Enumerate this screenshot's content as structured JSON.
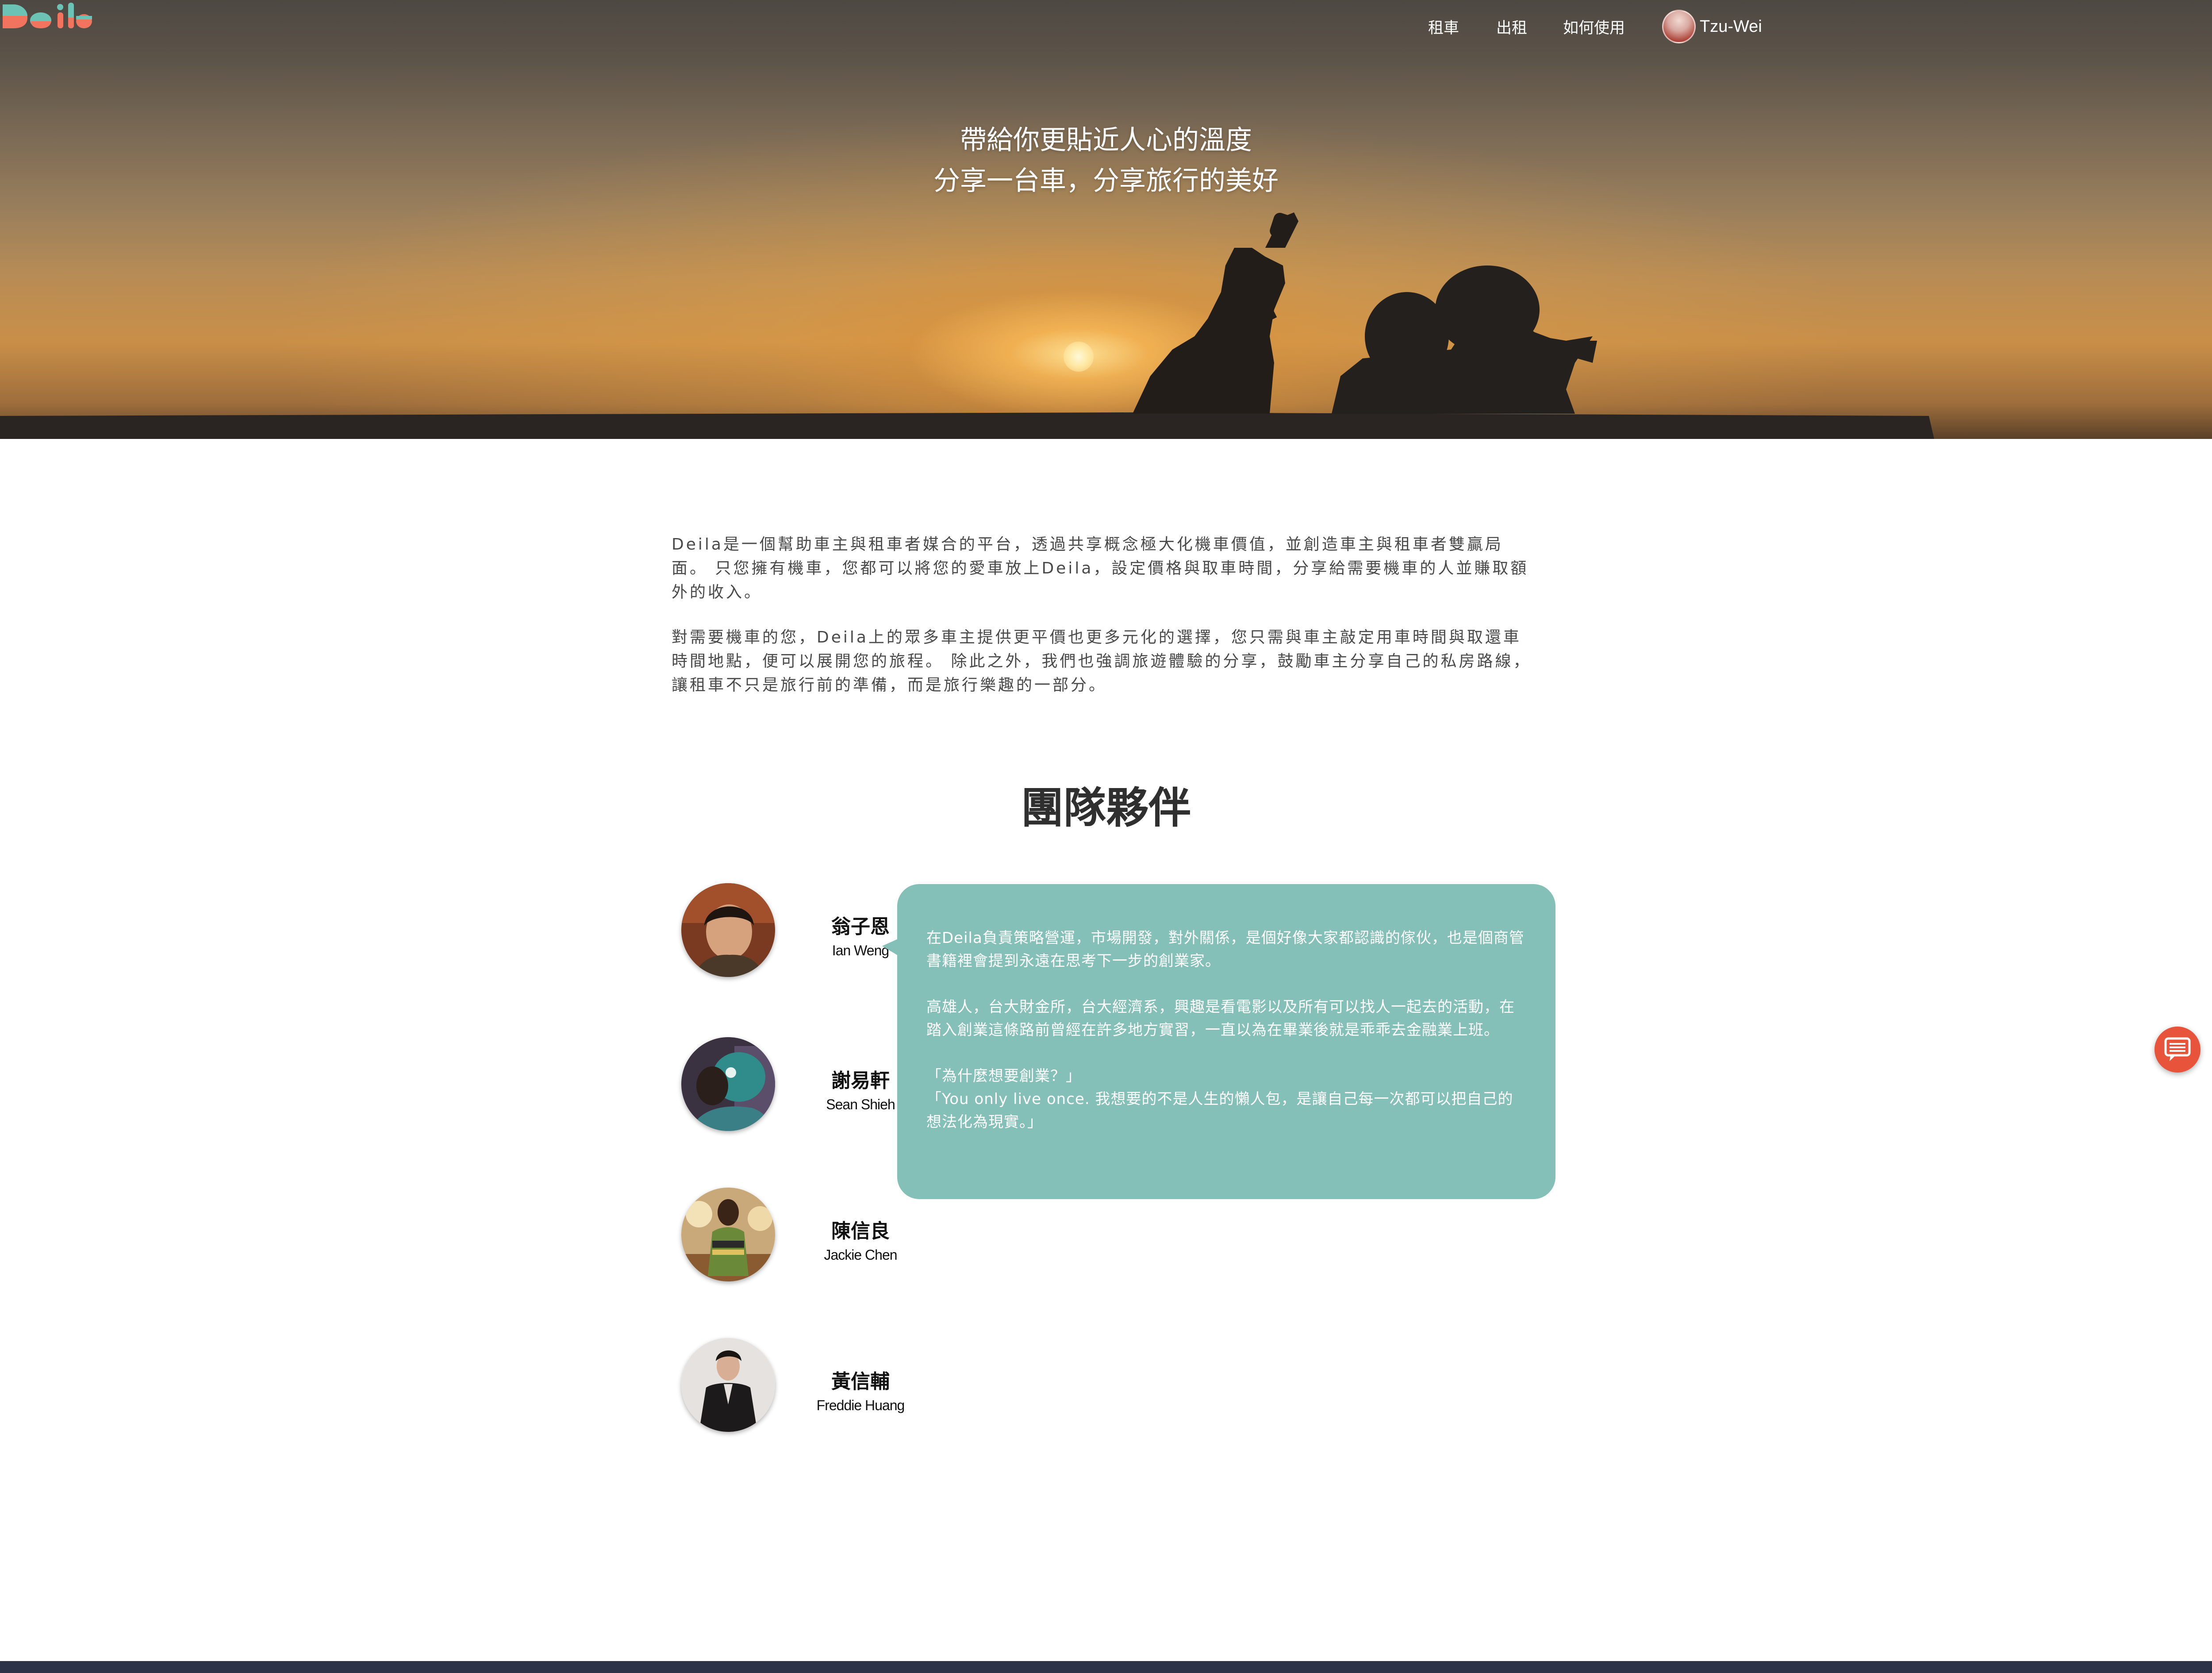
{
  "header": {
    "logo_text": "Deila",
    "nav": [
      {
        "label": "租車"
      },
      {
        "label": "出租"
      },
      {
        "label": "如何使用"
      }
    ],
    "user_name": "Tzu-Wei"
  },
  "hero": {
    "line1": "帶給你更貼近人心的溫度",
    "line2": "分享一台車，分享旅行的美好"
  },
  "intro": {
    "p1": "Deila是一個幫助車主與租車者媒合的平台，透過共享概念極大化機車價值，並創造車主與租車者雙贏局面。 只您擁有機車，您都可以將您的愛車放上Deila，設定價格與取車時間，分享給需要機車的人並賺取額外的收入。",
    "p2": "對需要機車的您，Deila上的眾多車主提供更平價也更多元化的選擇，您只需與車主敲定用車時間與取還車時間地點，便可以展開您的旅程。 除此之外，我們也強調旅遊體驗的分享，鼓勵車主分享自己的私房路線，讓租車不只是旅行前的準備，而是旅行樂趣的一部分。"
  },
  "team": {
    "title": "團隊夥伴",
    "members": [
      {
        "zh": "翁子恩",
        "en": "Ian Weng"
      },
      {
        "zh": "謝易軒",
        "en": "Sean Shieh"
      },
      {
        "zh": "陳信良",
        "en": "Jackie Chen"
      },
      {
        "zh": "黃信輔",
        "en": "Freddie Huang"
      }
    ],
    "bubble": {
      "p1": "在Deila負責策略營運，市場開發，對外關係，是個好像大家都認識的傢伙，也是個商管書籍裡會提到永遠在思考下一步的創業家。",
      "p2": "高雄人，台大財金所，台大經濟系，興趣是看電影以及所有可以找人一起去的活動，在踏入創業這條路前曾經在許多地方實習，一直以為在畢業後就是乖乖去金融業上班。",
      "p3_line1": "「為什麼想要創業？」",
      "p3_line2": "「You only live once. 我想要的不是人生的懶人包，是讓自己每一次都可以把自己的想法化為現實。」"
    },
    "colors": {
      "bubble": "#84c0b7",
      "chat": "#e8533b",
      "footer": "#2d3248"
    }
  },
  "icons": {
    "chat": "chat-icon",
    "avatar": "avatar"
  }
}
